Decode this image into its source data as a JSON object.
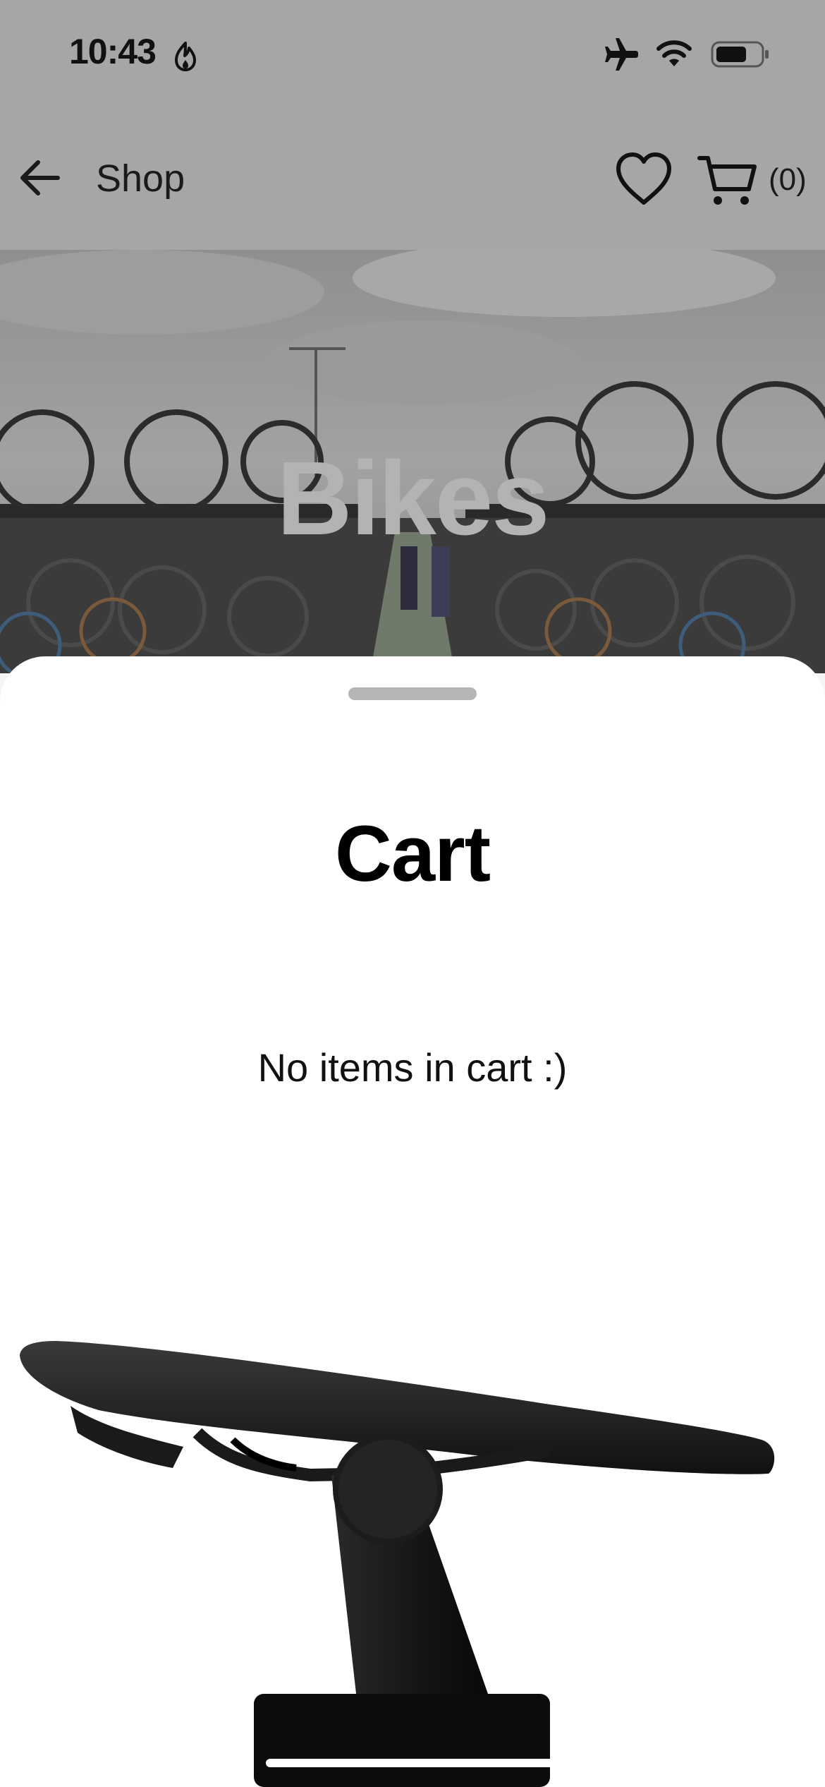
{
  "status_bar": {
    "time": "10:43",
    "icons": [
      "flame-icon",
      "airplane-icon",
      "wifi-icon",
      "battery-icon"
    ]
  },
  "nav": {
    "back_icon": "arrow-left-icon",
    "title": "Shop",
    "favorites_icon": "heart-icon",
    "cart_icon": "cart-icon",
    "cart_count": "(0)"
  },
  "hero": {
    "title": "Bikes"
  },
  "cart_sheet": {
    "title": "Cart",
    "empty_message": "No items in cart :)"
  },
  "colors": {
    "scrim": "#a6a6a6",
    "sheet_background": "#ffffff",
    "grabber": "#b5b5b5",
    "text_primary": "#000000"
  }
}
